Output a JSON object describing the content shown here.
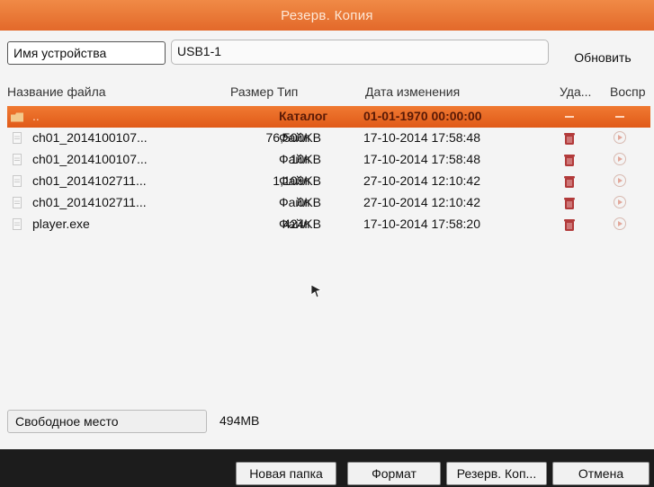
{
  "title": "Резерв. Копия",
  "device": {
    "label": "Имя устройства",
    "value": "USB1-1",
    "refresh_label": "Обновить"
  },
  "columns": {
    "name": "Название файла",
    "size_type": "Размер Тип",
    "date": "Дата изменения",
    "delete": "Уда...",
    "play": "Воспр"
  },
  "rows": [
    {
      "name": "..",
      "size": "",
      "type": "Каталог",
      "date": "01-01-1970 00:00:00",
      "icon": "folder-icon",
      "selected": true
    },
    {
      "name": "ch01_2014100107...",
      "size": "76,500KB",
      "type": "Файл",
      "date": "17-10-2014 17:58:48",
      "icon": "file-icon"
    },
    {
      "name": "ch01_2014100107...",
      "size": "10KB",
      "type": "Файл",
      "date": "17-10-2014 17:58:48",
      "icon": "file-icon"
    },
    {
      "name": "ch01_2014102711...",
      "size": "1,109KB",
      "type": "Файл",
      "date": "27-10-2014 12:10:42",
      "icon": "file-icon"
    },
    {
      "name": "ch01_2014102711...",
      "size": "0KB",
      "type": "Файл",
      "date": "27-10-2014 12:10:42",
      "icon": "file-icon"
    },
    {
      "name": "player.exe",
      "size": "424KB",
      "type": "Файл",
      "date": "17-10-2014 17:58:20",
      "icon": "file-icon"
    }
  ],
  "free_space": {
    "label": "Свободное место",
    "value": "494MB"
  },
  "buttons": {
    "new_folder": "Новая папка",
    "format": "Формат",
    "backup": "Резерв. Коп...",
    "cancel": "Отмена"
  },
  "colors": {
    "accent": "#e3692a",
    "selected_row": "#ea6a22",
    "delete_icon": "#b23a3a"
  }
}
